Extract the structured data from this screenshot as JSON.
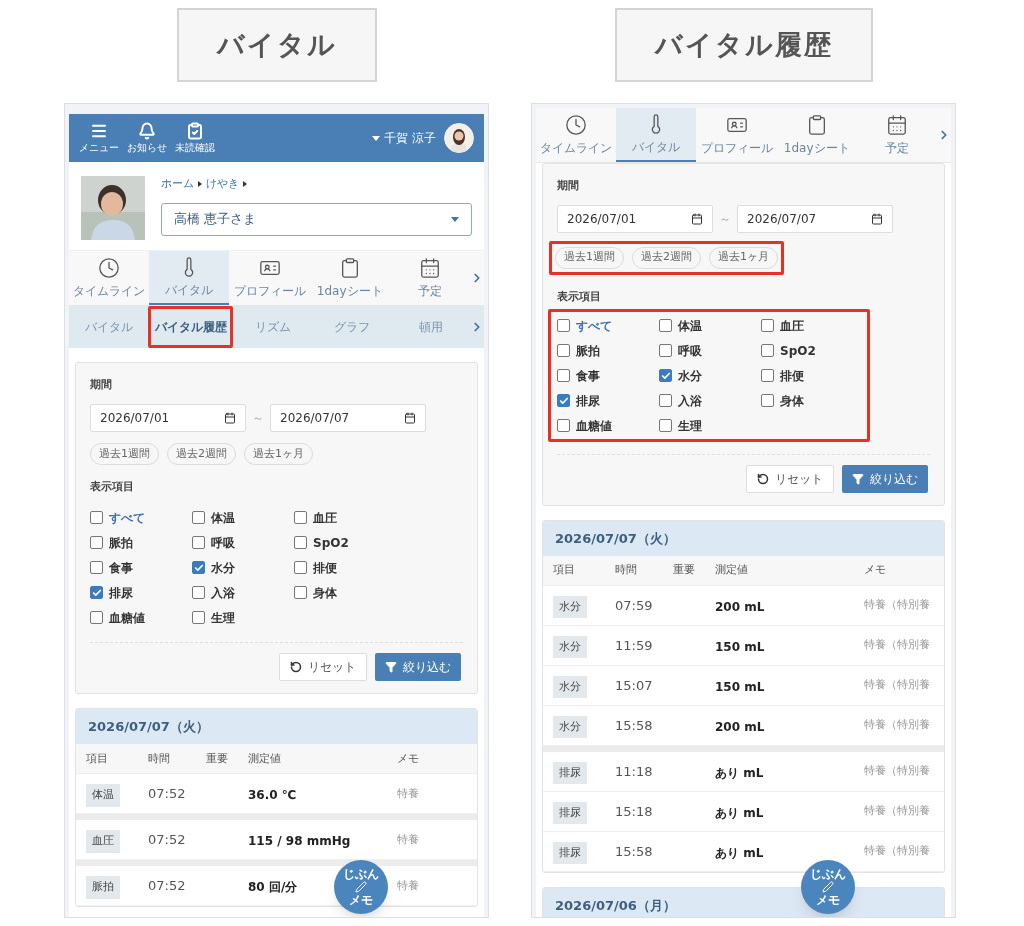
{
  "screens": [
    {
      "caption": "バイタル",
      "header": {
        "buttons": [
          {
            "label": "メニュー"
          },
          {
            "label": "お知らせ"
          },
          {
            "label": "未読確認"
          }
        ],
        "user": "千賀 涼子"
      },
      "resident": {
        "breadcrumb": [
          "ホーム",
          "けやき"
        ],
        "name": "高橋 恵子さま"
      },
      "tabs": [
        {
          "label": "タイムライン",
          "selected": false
        },
        {
          "label": "バイタル",
          "selected": true
        },
        {
          "label": "プロフィール",
          "selected": false
        },
        {
          "label": "1dayシート",
          "selected": false
        },
        {
          "label": "予定",
          "selected": false
        }
      ],
      "subtabs": [
        {
          "label": "バイタル",
          "selected": false,
          "highlighted": false
        },
        {
          "label": "バイタル履歴",
          "selected": true,
          "highlighted": true
        },
        {
          "label": "リズム",
          "selected": false,
          "highlighted": false
        },
        {
          "label": "グラフ",
          "selected": false,
          "highlighted": false
        },
        {
          "label": "頓用",
          "selected": false,
          "highlighted": false
        }
      ],
      "filter": {
        "period_label": "期間",
        "from": "2026/07/01",
        "separator": "～",
        "to": "2026/07/07",
        "presets": [
          "過去1週間",
          "過去2週間",
          "過去1ヶ月"
        ],
        "presets_highlighted": false,
        "items_label": "表示項目",
        "items_highlighted": false,
        "items": [
          {
            "label": "すべて",
            "kind": "all",
            "checked": false
          },
          {
            "label": "体温",
            "kind": "item",
            "checked": false
          },
          {
            "label": "血圧",
            "kind": "item",
            "checked": false
          },
          {
            "label": "脈拍",
            "kind": "item",
            "checked": false
          },
          {
            "label": "呼吸",
            "kind": "item",
            "checked": false
          },
          {
            "label": "SpO2",
            "kind": "item",
            "checked": false
          },
          {
            "label": "食事",
            "kind": "item",
            "checked": false
          },
          {
            "label": "水分",
            "kind": "item",
            "checked": true
          },
          {
            "label": "排便",
            "kind": "item",
            "checked": false
          },
          {
            "label": "排尿",
            "kind": "item",
            "checked": true
          },
          {
            "label": "入浴",
            "kind": "item",
            "checked": false
          },
          {
            "label": "身体",
            "kind": "item",
            "checked": false
          },
          {
            "label": "血糖値",
            "kind": "item",
            "checked": false
          },
          {
            "label": "生理",
            "kind": "item",
            "checked": false
          }
        ],
        "reset": "リセット",
        "apply": "絞り込む"
      },
      "days": [
        {
          "date": "2026/07/07（火）",
          "columns": [
            "項目",
            "時間",
            "重要",
            "測定値",
            "メモ"
          ],
          "groups": [
            {
              "rows": [
                {
                  "item": "体温",
                  "time": "07:52",
                  "value": "36.0 ℃",
                  "memo": "特養"
                }
              ]
            },
            {
              "rows": [
                {
                  "item": "血圧",
                  "time": "07:52",
                  "value": "115 / 98 mmHg",
                  "memo": "特養"
                }
              ]
            },
            {
              "rows": [
                {
                  "item": "脈拍",
                  "time": "07:52",
                  "value": "80 回/分",
                  "memo": "特養"
                }
              ]
            }
          ]
        }
      ],
      "fab": {
        "top": "じぶん",
        "bottom": "メモ"
      }
    },
    {
      "caption": "バイタル履歴",
      "tabs": [
        {
          "label": "タイムライン",
          "selected": false
        },
        {
          "label": "バイタル",
          "selected": true
        },
        {
          "label": "プロフィール",
          "selected": false
        },
        {
          "label": "1dayシート",
          "selected": false
        },
        {
          "label": "予定",
          "selected": false
        }
      ],
      "filter": {
        "period_label": "期間",
        "from": "2026/07/01",
        "separator": "～",
        "to": "2026/07/07",
        "presets": [
          "過去1週間",
          "過去2週間",
          "過去1ヶ月"
        ],
        "presets_highlighted": true,
        "items_label": "表示項目",
        "items_highlighted": true,
        "items": [
          {
            "label": "すべて",
            "kind": "all",
            "checked": false
          },
          {
            "label": "体温",
            "kind": "item",
            "checked": false
          },
          {
            "label": "血圧",
            "kind": "item",
            "checked": false
          },
          {
            "label": "脈拍",
            "kind": "item",
            "checked": false
          },
          {
            "label": "呼吸",
            "kind": "item",
            "checked": false
          },
          {
            "label": "SpO2",
            "kind": "item",
            "checked": false
          },
          {
            "label": "食事",
            "kind": "item",
            "checked": false
          },
          {
            "label": "水分",
            "kind": "item",
            "checked": true
          },
          {
            "label": "排便",
            "kind": "item",
            "checked": false
          },
          {
            "label": "排尿",
            "kind": "item",
            "checked": true
          },
          {
            "label": "入浴",
            "kind": "item",
            "checked": false
          },
          {
            "label": "身体",
            "kind": "item",
            "checked": false
          },
          {
            "label": "血糖値",
            "kind": "item",
            "checked": false
          },
          {
            "label": "生理",
            "kind": "item",
            "checked": false
          }
        ],
        "reset": "リセット",
        "apply": "絞り込む"
      },
      "days": [
        {
          "date": "2026/07/07（火）",
          "columns": [
            "項目",
            "時間",
            "重要",
            "測定値",
            "メモ"
          ],
          "groups": [
            {
              "rows": [
                {
                  "item": "水分",
                  "time": "07:59",
                  "value": "200 mL",
                  "memo": "特養（特別養"
                },
                {
                  "item": "水分",
                  "time": "11:59",
                  "value": "150 mL",
                  "memo": "特養（特別養"
                },
                {
                  "item": "水分",
                  "time": "15:07",
                  "value": "150 mL",
                  "memo": "特養（特別養"
                },
                {
                  "item": "水分",
                  "time": "15:58",
                  "value": "200 mL",
                  "memo": "特養（特別養"
                }
              ]
            },
            {
              "rows": [
                {
                  "item": "排尿",
                  "time": "11:18",
                  "value": "あり mL",
                  "memo": "特養（特別養"
                },
                {
                  "item": "排尿",
                  "time": "15:18",
                  "value": "あり mL",
                  "memo": "特養（特別養"
                },
                {
                  "item": "排尿",
                  "time": "15:58",
                  "value": "あり mL",
                  "memo": "特養（特別養"
                }
              ]
            }
          ]
        },
        {
          "date": "2026/07/06（月）"
        }
      ],
      "fab": {
        "top": "じぶん",
        "bottom": "メモ"
      }
    }
  ]
}
